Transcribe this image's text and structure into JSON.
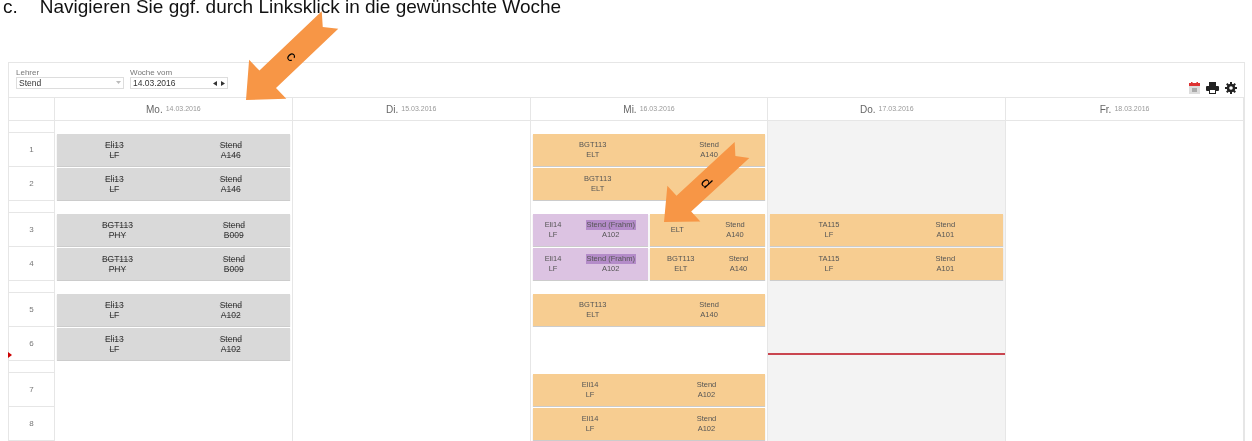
{
  "instruction": {
    "marker": "c.",
    "text": "Navigieren Sie ggf. durch Linksklick in die gewünschte Woche"
  },
  "toolbar": {
    "teacher": {
      "label": "Lehrer",
      "value": "Stend"
    },
    "week": {
      "label": "Woche vom",
      "value": "14.03.2016"
    }
  },
  "periods": [
    {
      "label": "1",
      "break_before": true,
      "current": false
    },
    {
      "label": "2",
      "break_before": false,
      "current": false
    },
    {
      "label": "3",
      "break_before": true,
      "current": false
    },
    {
      "label": "4",
      "break_before": false,
      "current": false
    },
    {
      "label": "5",
      "break_before": true,
      "current": false
    },
    {
      "label": "6",
      "break_before": false,
      "current": true
    },
    {
      "label": "7",
      "break_before": true,
      "current": false
    },
    {
      "label": "8",
      "break_before": false,
      "current": false
    }
  ],
  "days": [
    {
      "label": "Mo.",
      "date": "14.03.2016",
      "today": false,
      "periods": [
        {
          "kind": "lesson",
          "entries": [
            {
              "kind": "cancelled",
              "class_name": "Eli13",
              "subject": "LF",
              "teacher": "Stend",
              "room": "A146"
            }
          ]
        },
        {
          "kind": "lesson",
          "entries": [
            {
              "kind": "cancelled",
              "class_name": "Eli13",
              "subject": "LF",
              "teacher": "Stend",
              "room": "A146"
            }
          ]
        },
        {
          "kind": "lesson",
          "entries": [
            {
              "kind": "cancelled",
              "class_name": "BGT113",
              "subject": "PHY",
              "teacher": "Stend",
              "room": "B009"
            }
          ]
        },
        {
          "kind": "lesson",
          "entries": [
            {
              "kind": "cancelled",
              "class_name": "BGT113",
              "subject": "PHY",
              "teacher": "Stend",
              "room": "B009"
            }
          ]
        },
        {
          "kind": "lesson",
          "entries": [
            {
              "kind": "cancelled",
              "class_name": "Eli13",
              "subject": "LF",
              "teacher": "Stend",
              "room": "A102"
            }
          ]
        },
        {
          "kind": "lesson",
          "entries": [
            {
              "kind": "cancelled",
              "class_name": "Eli13",
              "subject": "LF",
              "teacher": "Stend",
              "room": "A102"
            }
          ]
        },
        {
          "kind": "free"
        },
        {
          "kind": "free"
        }
      ]
    },
    {
      "label": "Di.",
      "date": "15.03.2016",
      "today": false,
      "periods": [
        {
          "kind": "free"
        },
        {
          "kind": "free"
        },
        {
          "kind": "free"
        },
        {
          "kind": "free"
        },
        {
          "kind": "free"
        },
        {
          "kind": "free"
        },
        {
          "kind": "free"
        },
        {
          "kind": "free"
        }
      ]
    },
    {
      "label": "Mi.",
      "date": "16.03.2016",
      "today": false,
      "periods": [
        {
          "kind": "lesson",
          "entries": [
            {
              "kind": "regular",
              "class_name": "BGT113",
              "subject": "ELT",
              "teacher": "Stend",
              "room": "A140"
            }
          ]
        },
        {
          "kind": "lesson",
          "entries": [
            {
              "kind": "regular",
              "class_name": "BGT113",
              "subject": "ELT"
            }
          ]
        },
        {
          "kind": "lesson",
          "entries": [
            {
              "kind": "substitution",
              "class_name": "Eli14",
              "subject": "LF",
              "teacher": "Stend (Frahm)",
              "teacher_changed": true,
              "room": "A102"
            },
            {
              "kind": "regular",
              "subject": "ELT",
              "teacher": "Stend",
              "room": "A140"
            }
          ]
        },
        {
          "kind": "lesson",
          "entries": [
            {
              "kind": "substitution",
              "class_name": "Eli14",
              "subject": "LF",
              "teacher": "Stend (Frahm)",
              "teacher_changed": true,
              "room": "A102"
            },
            {
              "kind": "regular",
              "class_name": "BGT113",
              "subject": "ELT",
              "teacher": "Stend",
              "room": "A140"
            }
          ]
        },
        {
          "kind": "lesson",
          "entries": [
            {
              "kind": "regular",
              "class_name": "BGT113",
              "subject": "ELT",
              "teacher": "Stend",
              "room": "A140"
            }
          ]
        },
        {
          "kind": "free"
        },
        {
          "kind": "lesson",
          "entries": [
            {
              "kind": "regular",
              "class_name": "Eli14",
              "subject": "LF",
              "teacher": "Stend",
              "room": "A102"
            }
          ]
        },
        {
          "kind": "lesson",
          "entries": [
            {
              "kind": "regular",
              "class_name": "Eli14",
              "subject": "LF",
              "teacher": "Stend",
              "room": "A102"
            }
          ]
        }
      ]
    },
    {
      "label": "Do.",
      "date": "17.03.2016",
      "today": true,
      "periods": [
        {
          "kind": "free"
        },
        {
          "kind": "free"
        },
        {
          "kind": "lesson",
          "entries": [
            {
              "kind": "regular",
              "class_name": "TA115",
              "subject": "LF",
              "teacher": "Stend",
              "room": "A101"
            }
          ]
        },
        {
          "kind": "lesson",
          "entries": [
            {
              "kind": "regular",
              "class_name": "TA115",
              "subject": "LF",
              "teacher": "Stend",
              "room": "A101"
            }
          ]
        },
        {
          "kind": "free"
        },
        {
          "kind": "free"
        },
        {
          "kind": "free"
        },
        {
          "kind": "free"
        }
      ]
    },
    {
      "label": "Fr.",
      "date": "18.03.2016",
      "today": false,
      "periods": [
        {
          "kind": "free"
        },
        {
          "kind": "free"
        },
        {
          "kind": "free"
        },
        {
          "kind": "free"
        },
        {
          "kind": "free"
        },
        {
          "kind": "free"
        },
        {
          "kind": "free"
        },
        {
          "kind": "free"
        }
      ]
    }
  ],
  "annotations": [
    {
      "label": "c"
    },
    {
      "label": "d"
    }
  ]
}
